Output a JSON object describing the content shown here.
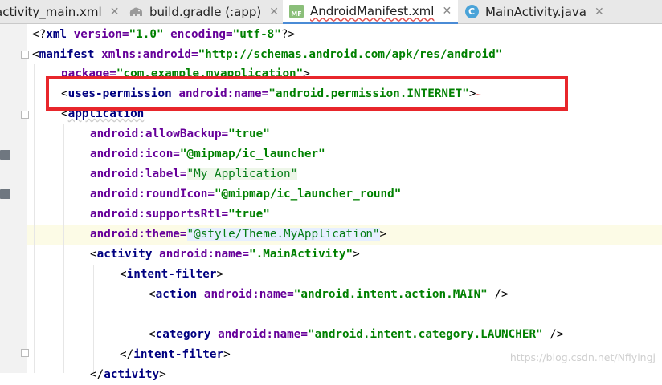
{
  "tabs": [
    {
      "label": "activity_main.xml",
      "icon": "none",
      "active": false
    },
    {
      "label": "build.gradle (:app)",
      "icon": "gradle-elephant-icon",
      "active": false
    },
    {
      "label": "AndroidManifest.xml",
      "icon": "manifest-file-icon",
      "icon_text": "MF",
      "active": true
    },
    {
      "label": "MainActivity.java",
      "icon": "class-c-icon",
      "icon_text": "C",
      "active": false
    }
  ],
  "close_glyph": "✕",
  "code": {
    "l1": {
      "open": "<?",
      "tag": "xml",
      "a1": " version=",
      "v1": "\"1.0\"",
      "a2": " encoding=",
      "v2": "\"utf-8\"",
      "close": "?>"
    },
    "l2": {
      "open": "<",
      "tag": "manifest",
      "a1": " xmlns:android=",
      "v1": "\"http://schemas.android.com/apk/res/android\""
    },
    "l3": {
      "a1": "package=",
      "v1": "\"com.example.myapplication\"",
      "close": ">"
    },
    "l4": {
      "open": "<",
      "tag": "uses-permission",
      "ns": " android:",
      "attr": "name=",
      "v1": "\"android.permission.INTERNET\"",
      "close": ">"
    },
    "l5": {
      "open": "<",
      "tag": "application"
    },
    "attrs": [
      {
        "ns": "android:",
        "attr": "allowBackup=",
        "value": "\"true\""
      },
      {
        "ns": "android:",
        "attr": "icon=",
        "value": "\"@mipmap/ic_launcher\""
      },
      {
        "ns": "android:",
        "attr": "label=",
        "value": "\"My Application\""
      },
      {
        "ns": "android:",
        "attr": "roundIcon=",
        "value": "\"@mipmap/ic_launcher_round\""
      },
      {
        "ns": "android:",
        "attr": "supportsRtl=",
        "value": "\"true\""
      }
    ],
    "theme": {
      "ns": "android:",
      "attr": "theme=",
      "value_a": "\"@style/Theme.MyApplicatio",
      "value_b": "n\"",
      "close": ">"
    },
    "activity": {
      "open": "<",
      "tag": "activity",
      "ns": " android:",
      "attr": "name=",
      "value": "\".MainActivity\"",
      "close": ">"
    },
    "intent_open": {
      "open": "<",
      "tag": "intent-filter",
      "close": ">"
    },
    "action": {
      "open": "<",
      "tag": "action",
      "ns": " android:",
      "attr": "name=",
      "value": "\"android.intent.action.MAIN\"",
      "close": " />"
    },
    "category": {
      "open": "<",
      "tag": "category",
      "ns": " android:",
      "attr": "name=",
      "value": "\"android.intent.category.LAUNCHER\"",
      "close": " />"
    },
    "intent_close": {
      "open": "</",
      "tag": "intent-filter",
      "close": ">"
    },
    "activity_close": {
      "open": "</",
      "tag": "activity",
      "close": ">"
    }
  },
  "watermark": "https://blog.csdn.net/Nfiyingj",
  "colors": {
    "tag": "#000080",
    "attr": "#660099",
    "value": "#008000",
    "annotation": "#e8262b",
    "active_tab": "#4a8bd6"
  }
}
